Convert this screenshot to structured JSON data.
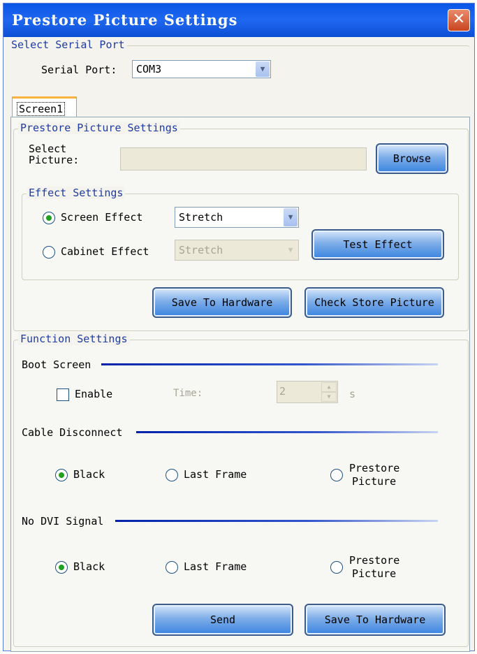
{
  "window": {
    "title": "Prestore Picture Settings",
    "close_glyph": "✕"
  },
  "serial": {
    "group_label": "Select Serial Port",
    "port_label": "Serial Port:",
    "port_value": "COM3"
  },
  "tab": {
    "label": "Screen1"
  },
  "prestore": {
    "group_label": "Prestore Picture Settings",
    "select_picture_label_1": "Select",
    "select_picture_label_2": "Picture:",
    "picture_path": "",
    "browse_label": "Browse",
    "effect": {
      "group_label": "Effect Settings",
      "screen_effect_label": "Screen Effect",
      "screen_effect_value": "Stretch",
      "screen_effect_selected": true,
      "cabinet_effect_label": "Cabinet Effect",
      "cabinet_effect_value": "Stretch",
      "cabinet_effect_selected": false,
      "test_effect_label": "Test Effect"
    },
    "save_to_hardware_label": "Save To Hardware",
    "check_store_picture_label": "Check Store Picture"
  },
  "function": {
    "group_label": "Function Settings",
    "boot_screen": {
      "title": "Boot Screen",
      "enable_label": "Enable",
      "enabled": false,
      "time_label": "Time:",
      "time_value": "2",
      "unit": "s"
    },
    "cable_disconnect": {
      "title": "Cable Disconnect",
      "options": [
        "Black",
        "Last Frame",
        "Prestore",
        "Picture"
      ],
      "selected": "Black"
    },
    "no_dvi": {
      "title": "No DVI Signal",
      "options": [
        "Black",
        "Last Frame",
        "Prestore",
        "Picture"
      ],
      "selected": "Black"
    },
    "send_label": "Send",
    "save_to_hardware_label": "Save To Hardware"
  },
  "icons": {
    "dropdown": "chevron-down-icon",
    "close": "close-icon",
    "spin_up": "spin-up-icon",
    "spin_down": "spin-down-icon"
  },
  "colors": {
    "titlebar": "#0a56e6",
    "legend_text": "#1e3ca0",
    "radio_dot": "#21a121"
  }
}
